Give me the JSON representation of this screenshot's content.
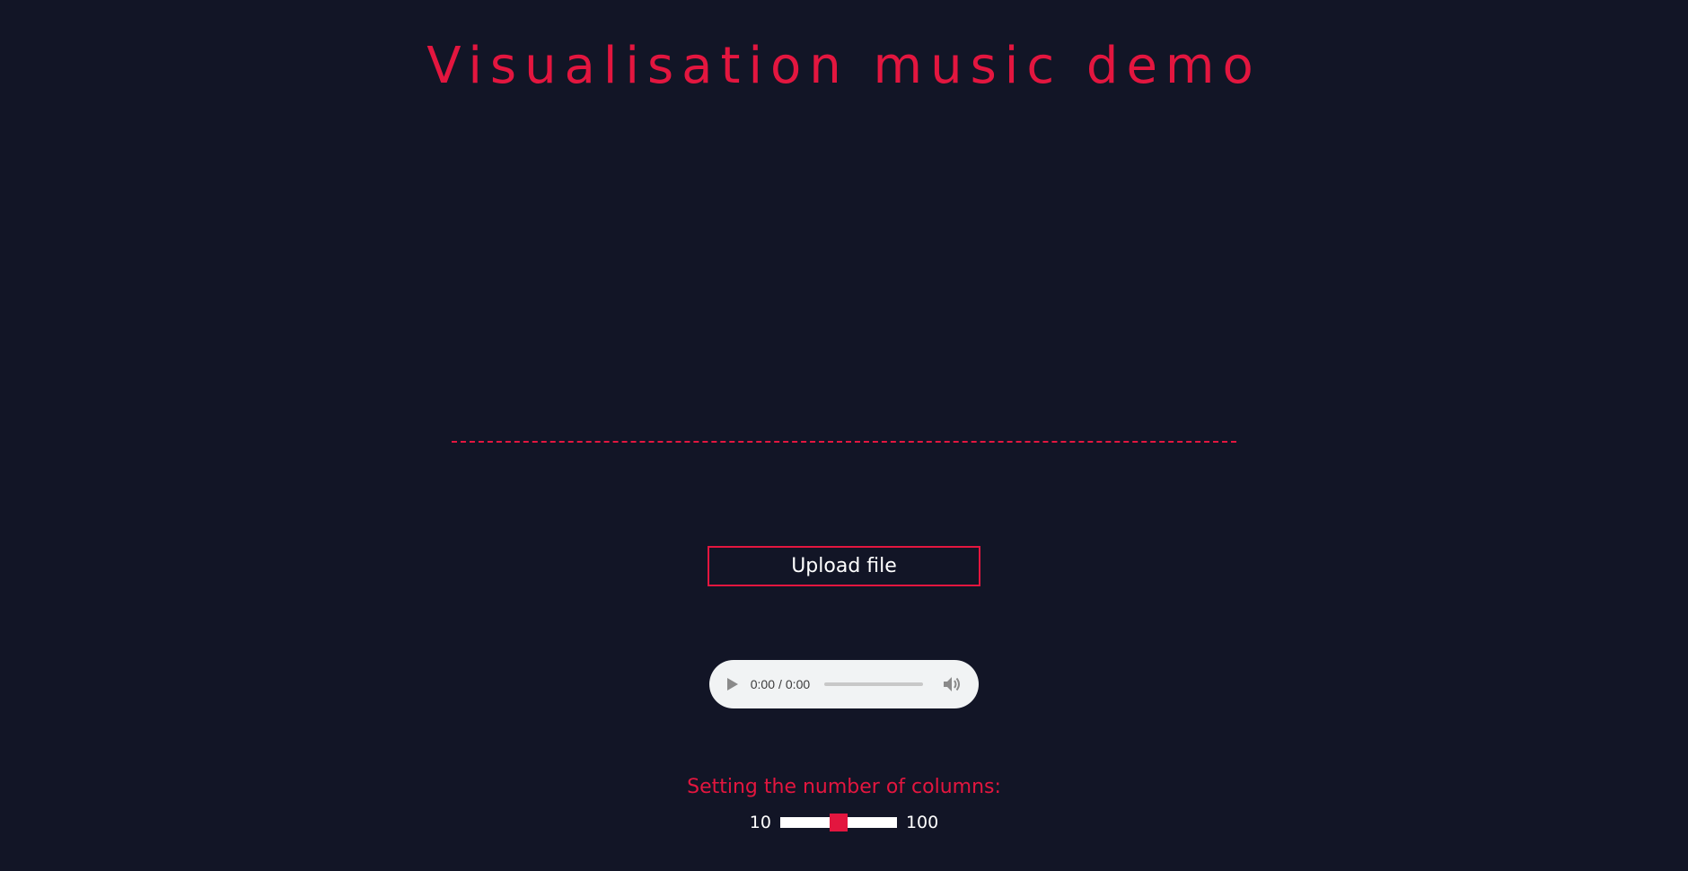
{
  "page": {
    "title": "Visualisation music demo"
  },
  "upload": {
    "label": "Upload file"
  },
  "audio": {
    "current_time": "0:00",
    "separator": "/",
    "duration": "0:00",
    "play_icon": "play-icon",
    "volume_icon": "volume-icon"
  },
  "columns": {
    "label": "Setting the number of columns:",
    "min_label": "10",
    "max_label": "100",
    "min": 10,
    "max": 100,
    "value": 55
  },
  "colors": {
    "background": "#121526",
    "accent": "#e3163f",
    "text": "#ffffff",
    "player_bg": "#f1f3f4"
  }
}
